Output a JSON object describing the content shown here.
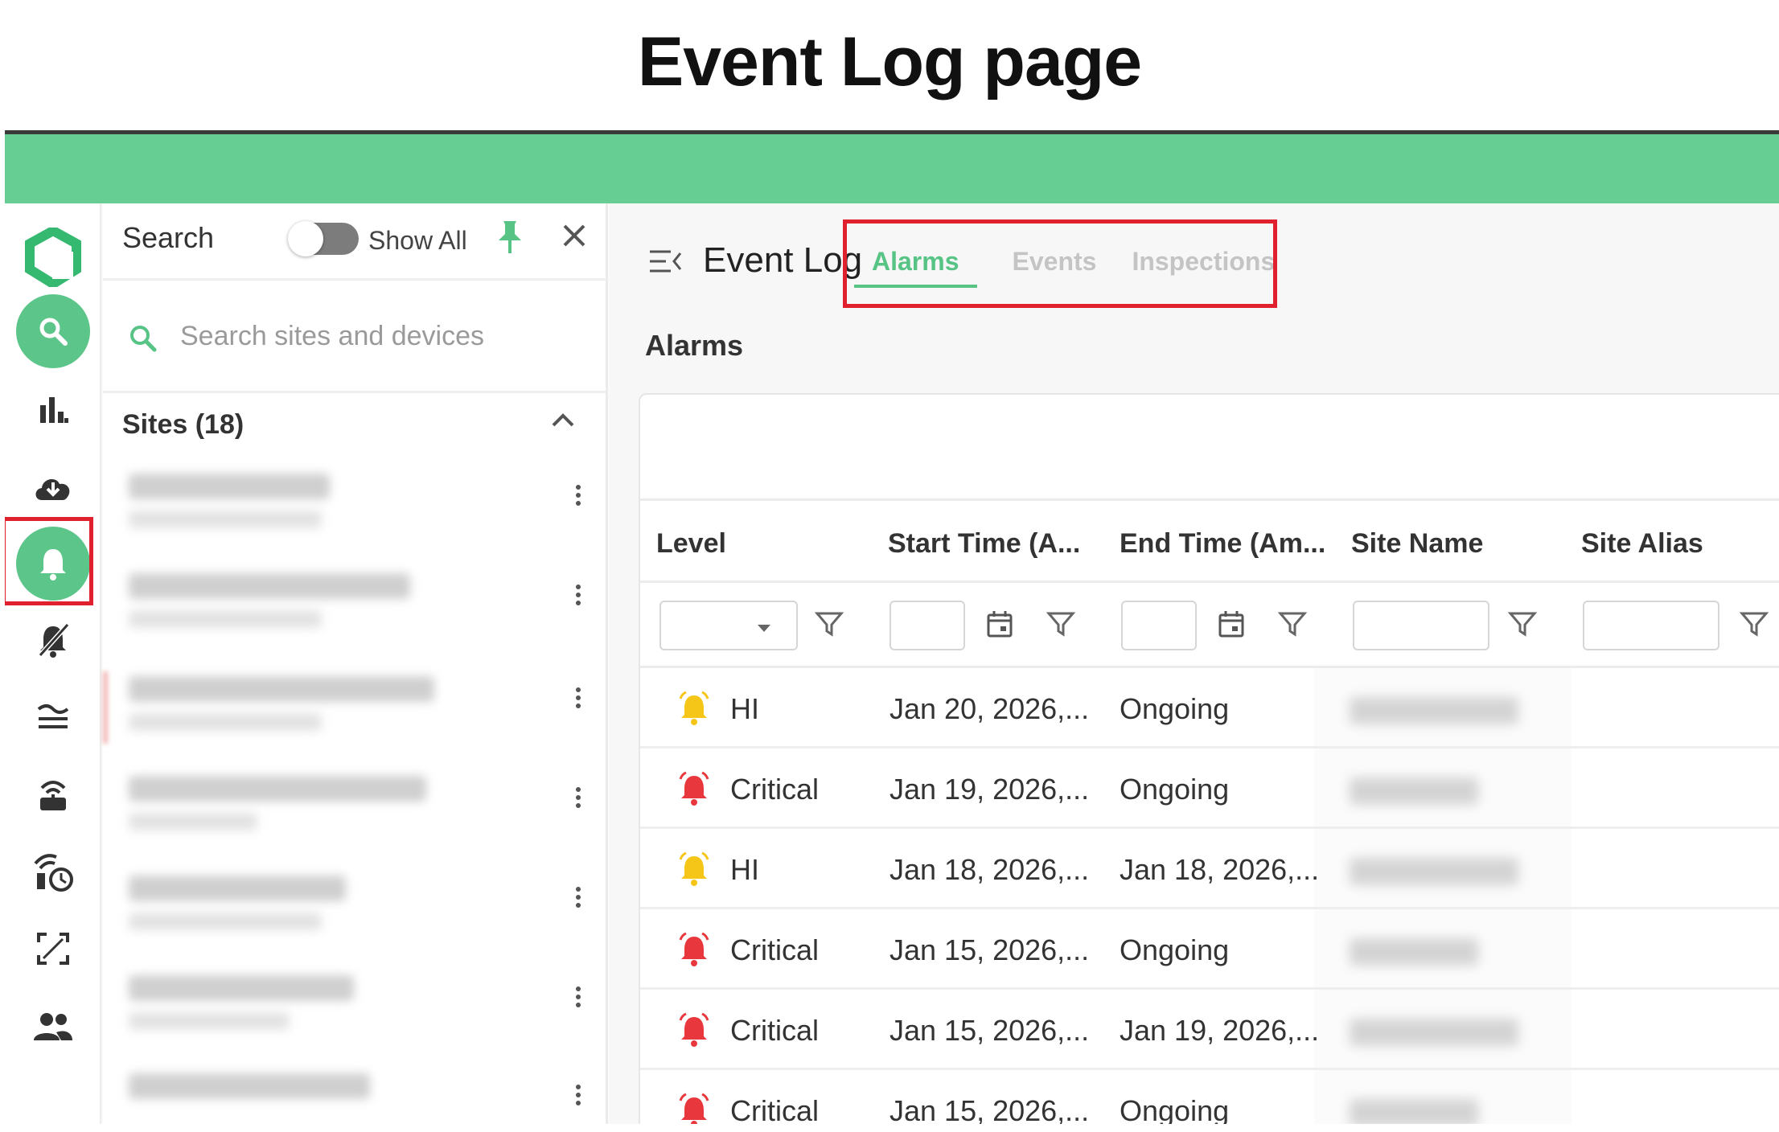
{
  "page_title": "Event Log page",
  "colors": {
    "brand_green": "#66cd93",
    "accent_green": "#57c486",
    "highlight_red": "#e0202c",
    "hi_bell": "#f5c518",
    "critical_bell": "#e8383d"
  },
  "rail": {
    "items": [
      {
        "icon": "logo-icon"
      },
      {
        "icon": "search-icon"
      },
      {
        "icon": "bar-chart-icon"
      },
      {
        "icon": "cloud-download-icon"
      },
      {
        "icon": "bell-icon"
      },
      {
        "icon": "bell-off-icon"
      },
      {
        "icon": "waves-icon"
      },
      {
        "icon": "router-icon"
      },
      {
        "icon": "schedule-signal-icon"
      },
      {
        "icon": "scan-icon"
      },
      {
        "icon": "users-icon"
      }
    ]
  },
  "site_panel": {
    "search_label": "Search",
    "show_all_label": "Show All",
    "search_placeholder": "Search sites and devices",
    "sites_title": "Sites (18)"
  },
  "main": {
    "title": "Event Log",
    "tabs": [
      {
        "label": "Alarms",
        "active": true
      },
      {
        "label": "Events",
        "active": false
      },
      {
        "label": "Inspections",
        "active": false
      }
    ],
    "section_title": "Alarms",
    "columns": [
      "Level",
      "Start Time (A...",
      "End Time (Am...",
      "Site Name",
      "Site Alias"
    ],
    "rows": [
      {
        "level": "HI",
        "start": "Jan 20, 2026,...",
        "end": "Ongoing"
      },
      {
        "level": "Critical",
        "start": "Jan 19, 2026,...",
        "end": "Ongoing"
      },
      {
        "level": "HI",
        "start": "Jan 18, 2026,...",
        "end": "Jan 18, 2026,..."
      },
      {
        "level": "Critical",
        "start": "Jan 15, 2026,...",
        "end": "Ongoing"
      },
      {
        "level": "Critical",
        "start": "Jan 15, 2026,...",
        "end": "Jan 19, 2026,..."
      },
      {
        "level": "Critical",
        "start": "Jan 15, 2026,...",
        "end": "Ongoing"
      }
    ]
  }
}
